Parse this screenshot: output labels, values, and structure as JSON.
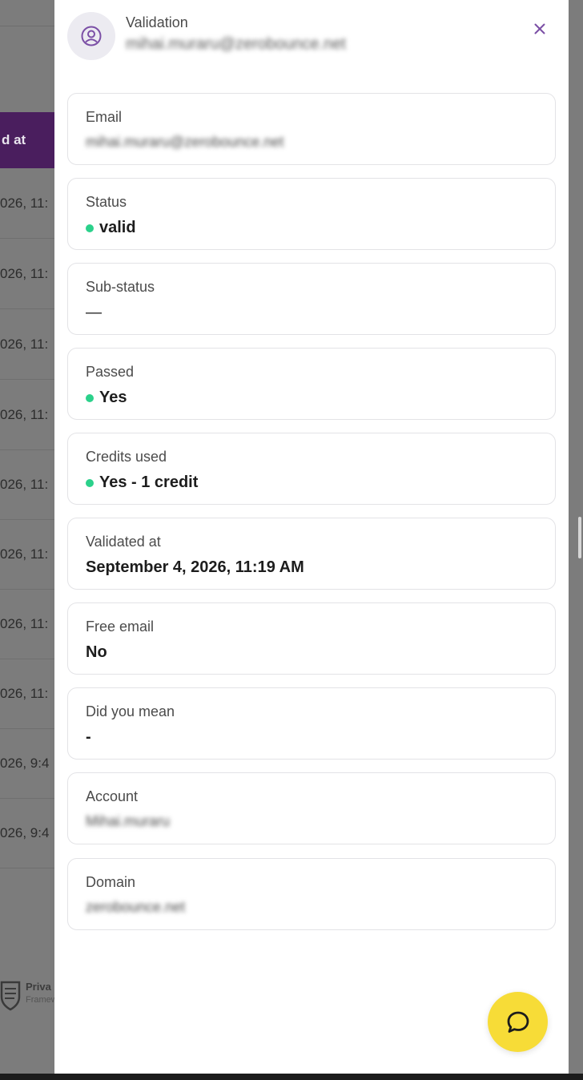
{
  "background": {
    "table_header_text": "d at",
    "rows": [
      "026, 11:",
      "026, 11:",
      "026, 11:",
      "026, 11:",
      "026, 11:",
      "026, 11:",
      "026, 11:",
      "026, 11:",
      "026, 9:4",
      "026, 9:4"
    ],
    "footer": {
      "line1": "Priva",
      "line2": "Framew"
    }
  },
  "drawer": {
    "title": "Validation",
    "email": "mihai.muraru@zerobounce.net",
    "close_icon": "close-icon",
    "avatar_icon": "user-circle-icon",
    "fields": [
      {
        "label": "Email",
        "value": "mihai.muraru@zerobounce.net",
        "dot": false,
        "style": "blur"
      },
      {
        "label": "Status",
        "value": "valid",
        "dot": true,
        "style": "bold"
      },
      {
        "label": "Sub-status",
        "value": "—",
        "dot": false,
        "style": "plain"
      },
      {
        "label": "Passed",
        "value": "Yes",
        "dot": true,
        "style": "bold"
      },
      {
        "label": "Credits used",
        "value": "Yes - 1 credit",
        "dot": true,
        "style": "bold"
      },
      {
        "label": "Validated at",
        "value": "September 4, 2026, 11:19 AM",
        "dot": false,
        "style": "bold"
      },
      {
        "label": "Free email",
        "value": "No",
        "dot": false,
        "style": "bold"
      },
      {
        "label": "Did you mean",
        "value": "-",
        "dot": false,
        "style": "bold"
      },
      {
        "label": "Account",
        "value": "Mihai.muraru",
        "dot": false,
        "style": "blur"
      },
      {
        "label": "Domain",
        "value": "zerobounce.net",
        "dot": false,
        "style": "blur"
      }
    ]
  },
  "chat": {
    "icon": "chat-bubble-icon"
  },
  "colors": {
    "accent": "#7b4fa6",
    "status_dot": "#2bd18b",
    "chat_button": "#f7dc37",
    "header_bg": "#4a1e5e"
  }
}
